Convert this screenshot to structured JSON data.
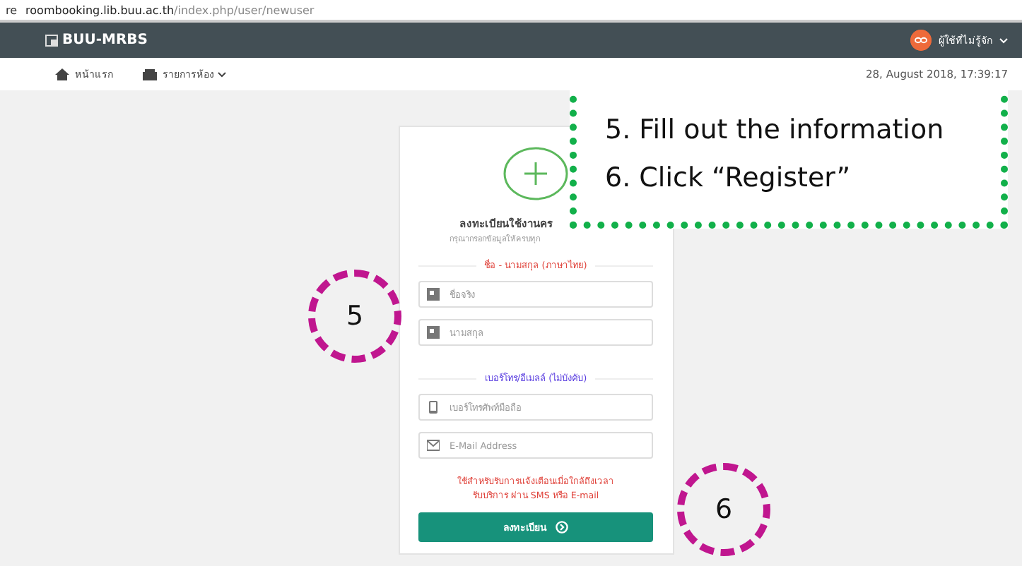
{
  "address_bar": {
    "prefix": "re",
    "url_host": "roombooking.lib.buu.ac.th",
    "url_path": "/index.php/user/newuser"
  },
  "header": {
    "logo": "BUU-MRBS",
    "user": "ผู้ใช้ที่ไม่รู้จัก"
  },
  "nav": [
    {
      "label": "หน้าแรก",
      "dropdown": false
    },
    {
      "label": "รายการห้อง",
      "dropdown": true
    }
  ],
  "datetime": "28, August 2018, 17:39:17",
  "form": {
    "title": "ลงทะเบียนใช้งานคร",
    "subtitle": "กรุณากรอกข้อมูลให้ครบทุก",
    "sections": [
      {
        "label": "ชื่อ - นามสกุล (ภาษาไทย)",
        "color": "#e0443c",
        "fields": [
          {
            "kind": "card",
            "placeholder": "ชื่อจริง"
          },
          {
            "kind": "card",
            "placeholder": "นามสกุล"
          }
        ]
      },
      {
        "label": "เบอร์โทร/อีเมลล์ (ไม่บังคับ)",
        "color": "#5a3ee0",
        "fields": [
          {
            "kind": "phone",
            "placeholder": "เบอร์โทรศัพท์มือถือ"
          },
          {
            "kind": "mail",
            "placeholder": "E-Mail Address"
          }
        ]
      }
    ],
    "note": [
      "ใช้สำหรับรับการแจ้งเตือนเมื่อใกล้ถึงเวลา",
      "รับบริการ ผ่าน SMS หรือ E-mail"
    ],
    "submit": "ลงทะเบียน"
  },
  "annotation": {
    "steps": [
      "5. Fill out the information",
      "6. Click “Register”"
    ],
    "markers": [
      "5",
      "6"
    ]
  }
}
